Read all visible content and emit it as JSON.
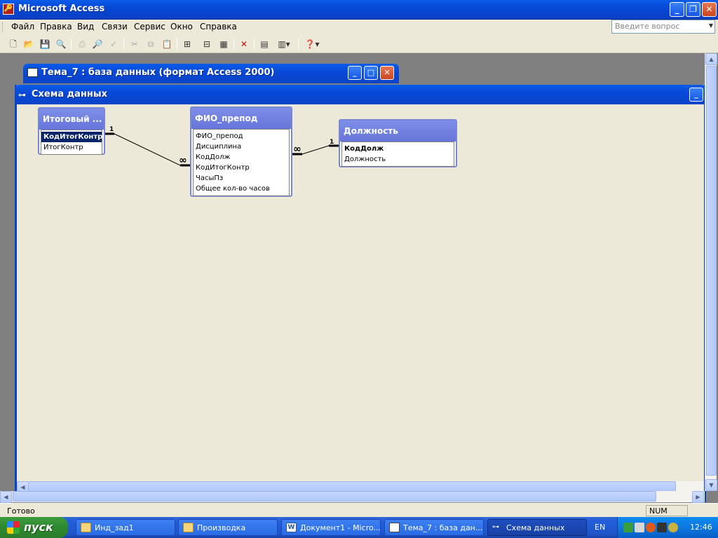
{
  "app": {
    "title": "Microsoft Access"
  },
  "menu": {
    "items": [
      "Файл",
      "Правка",
      "Вид",
      "Связи",
      "Сервис",
      "Окно",
      "Справка"
    ]
  },
  "ask_box": {
    "placeholder": "Введите вопрос"
  },
  "toolbar": {
    "icons": [
      "new-icon",
      "open-icon",
      "save-icon",
      "save-search-icon",
      "print-icon",
      "print-preview-icon",
      "spelling-icon",
      "cut-icon",
      "copy-icon",
      "paste-icon",
      "show-table-icon",
      "direct-relationships-icon",
      "all-relationships-icon",
      "delete-icon",
      "properties-icon",
      "new-object-icon",
      "help-icon"
    ]
  },
  "db_window": {
    "title": "Тема_7 : база данных (формат Access 2000)"
  },
  "schema_window": {
    "title": "Схема данных"
  },
  "tables": [
    {
      "name": "Итоговый ...",
      "fields": [
        "КодИтогКонтр",
        "ИтогКонтр"
      ],
      "selected_field": "КодИтогКонтр"
    },
    {
      "name": "ФИО_препод",
      "fields": [
        "ФИО_препод",
        "Дисциплина",
        "КодДолж",
        "КодИтогКонтр",
        "ЧасыПз",
        "Общее кол-во часов"
      ]
    },
    {
      "name": "Должность",
      "fields": [
        "КодДолж",
        "Должность"
      ],
      "key_field": "КодДолж"
    }
  ],
  "relationships": [
    {
      "from_table": "Итоговый ...",
      "from_field": "КодИтогКонтр",
      "from_label": "1",
      "to_table": "ФИО_препод",
      "to_field": "КодИтогКонтр",
      "to_label": "∞"
    },
    {
      "from_table": "Должность",
      "from_field": "КодДолж",
      "from_label": "1",
      "to_table": "ФИО_препод",
      "to_field": "КодДолж",
      "to_label": "∞"
    }
  ],
  "status": {
    "text": "Готово",
    "indicator": "NUM"
  },
  "taskbar": {
    "start_label": "пуск",
    "tasks": [
      "Инд_зад1",
      "Производка",
      "Документ1 - Micro...",
      "Тема_7 : база дан...",
      "Схема данных"
    ],
    "active_task": "Схема данных",
    "language": "EN",
    "clock": "12:46"
  },
  "colors": {
    "title_bar": "#0848d6",
    "table_header": "#7080e0",
    "selection": "#0a246a",
    "start_button": "#3c9b3c"
  }
}
